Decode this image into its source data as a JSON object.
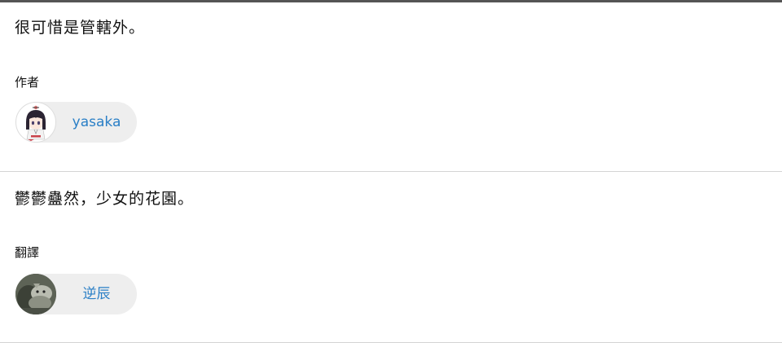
{
  "entries": [
    {
      "quote": "很可惜是管轄外。",
      "role_label": "作者",
      "person": {
        "name": "yasaka",
        "avatar_icon": "anime-girl-avatar-icon"
      }
    },
    {
      "quote": "鬱鬱蠱然，少女的花園。",
      "role_label": "翻譯",
      "person": {
        "name": "逆辰",
        "avatar_icon": "photo-avatar-icon"
      }
    }
  ],
  "colors": {
    "link": "#2a7fc6",
    "chip_background": "#eeeeee",
    "divider": "#d4d4d4",
    "top_border": "#555555"
  }
}
